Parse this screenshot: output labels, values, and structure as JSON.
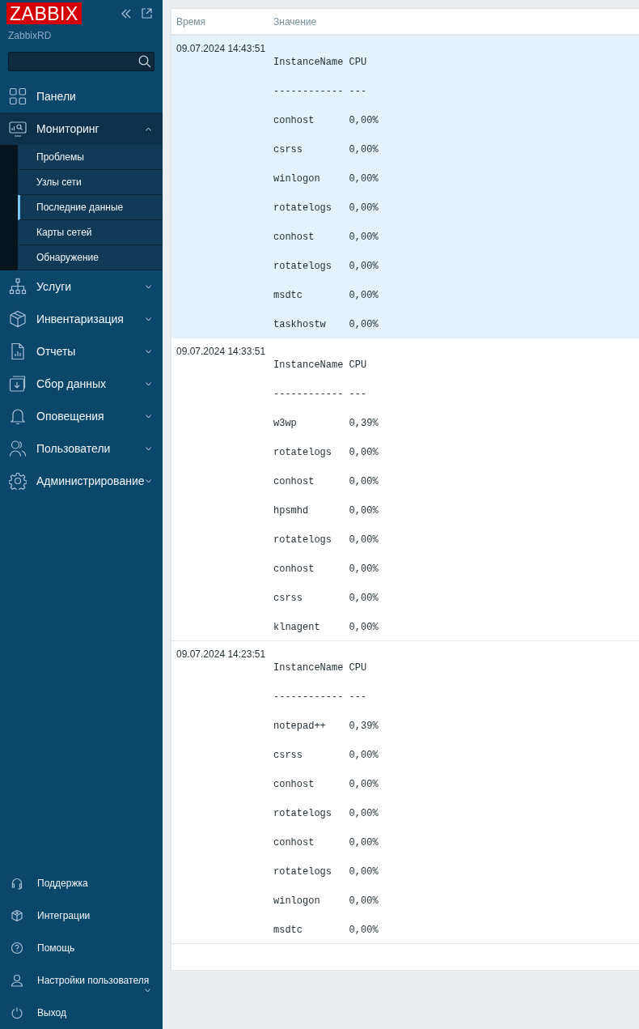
{
  "sidebar": {
    "logo": "ZABBIX",
    "server": "ZabbixRD",
    "menu": [
      {
        "label": "Панели",
        "kind": "link"
      },
      {
        "label": "Мониторинг",
        "kind": "group",
        "expanded": true,
        "children": [
          {
            "label": "Проблемы",
            "selected": false
          },
          {
            "label": "Узлы сети",
            "selected": false
          },
          {
            "label": "Последние данные",
            "selected": true
          },
          {
            "label": "Карты сетей",
            "selected": false
          },
          {
            "label": "Обнаружение",
            "selected": false
          }
        ]
      },
      {
        "label": "Услуги",
        "kind": "group",
        "expanded": false
      },
      {
        "label": "Инвентаризация",
        "kind": "group",
        "expanded": false
      },
      {
        "label": "Отчеты",
        "kind": "group",
        "expanded": false
      },
      {
        "label": "Сбор данных",
        "kind": "group",
        "expanded": false
      },
      {
        "label": "Оповещения",
        "kind": "group",
        "expanded": false
      },
      {
        "label": "Пользователи",
        "kind": "group",
        "expanded": false
      },
      {
        "label": "Администрирование",
        "kind": "group",
        "expanded": false
      }
    ],
    "bottom": [
      {
        "label": "Поддержка",
        "kind": "link"
      },
      {
        "label": "Интеграции",
        "kind": "link"
      },
      {
        "label": "Помощь",
        "kind": "link"
      },
      {
        "label": "Настройки пользователя",
        "kind": "group",
        "expanded": false
      },
      {
        "label": "Выход",
        "kind": "link"
      }
    ]
  },
  "table": {
    "columns": [
      "Время",
      "Значение"
    ],
    "rows": [
      {
        "time": "09.07.2024 14:43:51",
        "selected": true,
        "value_lines": [
          "InstanceName CPU",
          "------------ ---",
          "conhost      0,00%",
          "csrss        0,00%",
          "winlogon     0,00%",
          "rotatelogs   0,00%",
          "conhost      0,00%",
          "rotatelogs   0,00%",
          "msdtc        0,00%",
          "taskhostw    0,00%"
        ]
      },
      {
        "time": "09.07.2024 14:33:51",
        "selected": false,
        "value_lines": [
          "InstanceName CPU",
          "------------ ---",
          "w3wp         0,39%",
          "rotatelogs   0,00%",
          "conhost      0,00%",
          "hpsmhd       0,00%",
          "rotatelogs   0,00%",
          "conhost      0,00%",
          "csrss        0,00%",
          "klnagent     0,00%"
        ]
      },
      {
        "time": "09.07.2024 14:23:51",
        "selected": false,
        "value_lines": [
          "InstanceName CPU",
          "------------ ---",
          "notepad++    0,39%",
          "csrss        0,00%",
          "conhost      0,00%",
          "rotatelogs   0,00%",
          "conhost      0,00%",
          "rotatelogs   0,00%",
          "winlogon     0,00%",
          "msdtc        0,00%"
        ]
      }
    ]
  }
}
